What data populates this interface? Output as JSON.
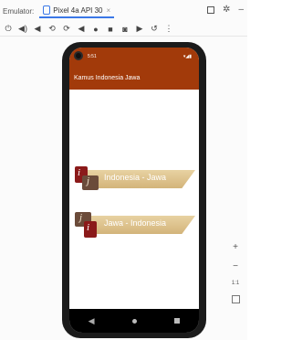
{
  "emulator": {
    "label": "Emulator:",
    "tab_title": "Pixel 4a API 30",
    "tab_close": "×"
  },
  "toolbar_icons": [
    "power-icon",
    "volume-up-icon",
    "volume-down-icon",
    "rotate-left-icon",
    "rotate-right-icon",
    "back-icon",
    "home-icon",
    "stop-icon",
    "camera-icon",
    "video-icon",
    "undo-icon",
    "more-icon"
  ],
  "phone": {
    "status": {
      "time": "5:51",
      "icons_right": "▾◢▮"
    },
    "appbar_title": "Kamus Indonesia Jawa",
    "buttons": [
      {
        "label": "Indonesia - Jawa"
      },
      {
        "label": "Jawa - Indonesia"
      }
    ],
    "nav": {
      "back": "◀",
      "home": "●",
      "recent": "■"
    }
  },
  "side_controls": {
    "zoom_in": "+",
    "zoom_out": "−",
    "ratio": "1:1"
  },
  "colors": {
    "appbar": "#a23a0a",
    "banner": "#e0c48f",
    "book_red": "#8b1a1a",
    "book_brown": "#6b4b3a"
  }
}
